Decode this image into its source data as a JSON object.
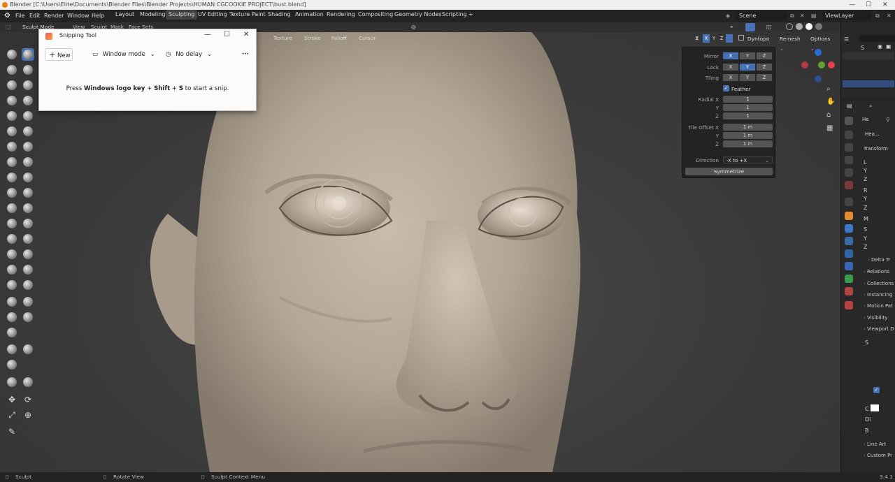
{
  "window": {
    "title": "Blender [C:\\Users\\Elite\\Documents\\Blender Files\\Blender Projects\\HUMAN CGCOOKIE PROJECT\\bust.blend]"
  },
  "menu": [
    "File",
    "Edit",
    "Render",
    "Window",
    "Help"
  ],
  "workspaces": [
    "Layout",
    "Modeling",
    "Sculpting",
    "UV Editing",
    "Texture Paint",
    "Shading",
    "Animation",
    "Rendering",
    "Compositing",
    "Geometry Nodes",
    "Scripting",
    "+"
  ],
  "active_workspace": "Sculpting",
  "scene": "Scene",
  "view_layer": "ViewLayer",
  "header": {
    "mode": "Sculpt Mode",
    "menus": [
      "View",
      "Sculpt",
      "Mask",
      "Face Sets"
    ]
  },
  "tool_header": {
    "items": [
      "h",
      "Texture",
      "Stroke",
      "Falloff",
      "Cursor"
    ],
    "axes": [
      "X",
      "Y",
      "Z"
    ],
    "dyntopo": "Dyntopo",
    "remesh": "Remesh",
    "options": "Options"
  },
  "snipping_tool": {
    "title": "Snipping Tool",
    "new_label": "New",
    "mode_label": "Window mode",
    "delay_label": "No delay",
    "more": "···",
    "msg_pre": "Press ",
    "msg_key1": "Windows logo key",
    "msg_plus1": " + ",
    "msg_key2": "Shift",
    "msg_plus2": " + ",
    "msg_key3": "S",
    "msg_post": " to start a snip."
  },
  "symmetry": {
    "mirror_label": "Mirror",
    "lock_label": "Lock",
    "tiling_label": "Tiling",
    "axes": [
      "X",
      "Y",
      "Z"
    ],
    "feather_label": "Feather",
    "radial_x_label": "Radial X",
    "radial_x": "1",
    "radial_y_label": "Y",
    "radial_y": "1",
    "radial_z_label": "Z",
    "radial_z": "1",
    "tile_offset_x_label": "Tile Offset X",
    "tile_x": "1 m",
    "tile_offset_y_label": "Y",
    "tile_y": "1 m",
    "tile_offset_z_label": "Z",
    "tile_z": "1 m",
    "direction_label": "Direction",
    "direction_value": "-X to +X",
    "symmetrize_label": "Symmetrize"
  },
  "props": {
    "object_name": "He",
    "mesh_name": "Hea...",
    "transform": "Transform",
    "rows": [
      "L",
      "Y",
      "Z",
      "R",
      "Y",
      "Z",
      "M",
      "S",
      "Y",
      "Z"
    ],
    "sections": [
      "Delta Tr",
      "Relations",
      "Collections",
      "Instancing",
      "Motion Pat",
      "Visibility",
      "Viewport D",
      "Line Art",
      "Custom Pr"
    ],
    "vp_rows": [
      "S",
      "C",
      "Di",
      "B"
    ],
    "outliner_item": "S"
  },
  "status": {
    "left": "Sculpt",
    "mid": "Rotate View",
    "right": "Sculpt Context Menu",
    "version": "3.4.1"
  },
  "colors": {
    "accent": "#4772b3",
    "bg": "#303030",
    "sculpt": "#b7aa9a"
  }
}
